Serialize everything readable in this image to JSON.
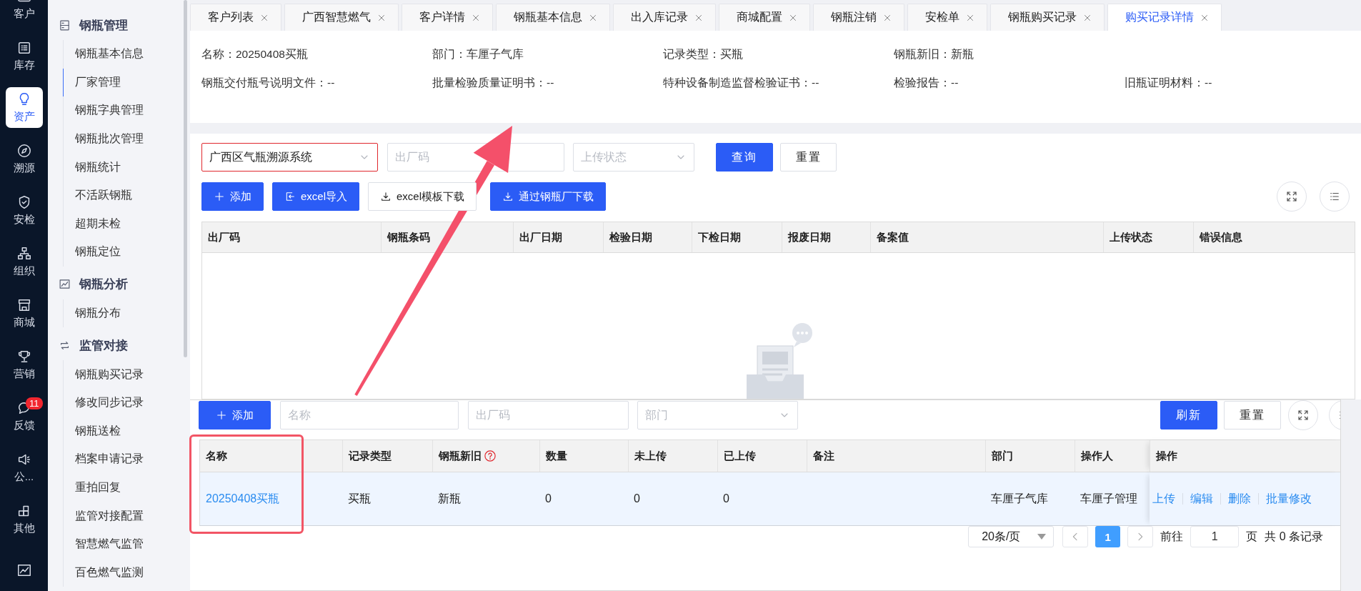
{
  "rail": [
    {
      "label": "客户",
      "selected": false
    },
    {
      "label": "库存",
      "selected": false
    },
    {
      "label": "资产",
      "selected": true
    },
    {
      "label": "溯源",
      "selected": false
    },
    {
      "label": "安检",
      "selected": false
    },
    {
      "label": "组织",
      "selected": false
    },
    {
      "label": "商城",
      "selected": false
    },
    {
      "label": "营销",
      "selected": false
    },
    {
      "label": "反馈",
      "selected": false,
      "badge": "11"
    },
    {
      "label": "公...",
      "selected": false
    },
    {
      "label": "其他",
      "selected": false
    },
    {
      "selected": false
    }
  ],
  "menu": [
    {
      "title": "钢瓶管理",
      "items": [
        {
          "label": "钢瓶基本信息",
          "selected": false
        },
        {
          "label": "厂家管理",
          "selected": true
        },
        {
          "label": "钢瓶字典管理",
          "selected": false
        },
        {
          "label": "钢瓶批次管理",
          "selected": false
        },
        {
          "label": "钢瓶统计",
          "selected": false
        },
        {
          "label": "不活跃钢瓶",
          "selected": false
        },
        {
          "label": "超期未检",
          "selected": false
        },
        {
          "label": "钢瓶定位",
          "selected": false
        }
      ]
    },
    {
      "title": "钢瓶分析",
      "items": [
        {
          "label": "钢瓶分布",
          "selected": false
        }
      ]
    },
    {
      "title": "监管对接",
      "items": [
        {
          "label": "钢瓶购买记录",
          "selected": false
        },
        {
          "label": "修改同步记录",
          "selected": false
        },
        {
          "label": "钢瓶送检",
          "selected": false
        },
        {
          "label": "档案申请记录",
          "selected": false
        },
        {
          "label": "重拍回复",
          "selected": false
        },
        {
          "label": "监管对接配置",
          "selected": false
        },
        {
          "label": "智慧燃气监管",
          "selected": false
        },
        {
          "label": "百色燃气监测",
          "selected": false
        }
      ]
    }
  ],
  "tabs": [
    {
      "label": "客户列表",
      "selected": false
    },
    {
      "label": "广西智慧燃气",
      "selected": false
    },
    {
      "label": "客户详情",
      "selected": false
    },
    {
      "label": "钢瓶基本信息",
      "selected": false
    },
    {
      "label": "出入库记录",
      "selected": false
    },
    {
      "label": "商城配置",
      "selected": false
    },
    {
      "label": "钢瓶注销",
      "selected": false
    },
    {
      "label": "安检单",
      "selected": false
    },
    {
      "label": "钢瓶购买记录",
      "selected": false
    },
    {
      "label": "购买记录详情",
      "selected": true
    }
  ],
  "details": [
    [
      "名称：20250408买瓶",
      "部门：车厘子气库",
      "记录类型：买瓶",
      "钢瓶新旧：新瓶"
    ],
    [
      "钢瓶交付瓶号说明文件：--",
      "批量检验质量证明书：--",
      "特种设备制造监督检验证书：--",
      "检验报告：--",
      "旧瓶证明材料：--"
    ]
  ],
  "filter": {
    "system_select": "广西区气瓶溯源系统",
    "factory_code_placeholder": "出厂码",
    "upload_status_placeholder": "上传状态",
    "search_button": "查询",
    "reset_button": "重置"
  },
  "toolbar": [
    {
      "label": "添加",
      "kind": "add",
      "primary": true
    },
    {
      "label": "excel导入",
      "kind": "import",
      "primary": true
    },
    {
      "label": "excel模板下载",
      "kind": "download",
      "primary": false
    },
    {
      "label": "通过钢瓶厂下载",
      "kind": "download",
      "primary": true
    }
  ],
  "table": {
    "columns": [
      "出厂码",
      "钢瓶条码",
      "出厂日期",
      "检验日期",
      "下检日期",
      "报废日期",
      "备案值",
      "上传状态",
      "错误信息"
    ]
  },
  "purchase_panel": {
    "add_button": "添加",
    "name_placeholder": "名称",
    "code_placeholder": "出厂码",
    "department_placeholder": "部门",
    "refresh_button": "刷新",
    "reset_button": "重置",
    "columns": [
      {
        "label": "名称",
        "help": false
      },
      {
        "label": "记录类型",
        "help": false
      },
      {
        "label": "钢瓶新旧",
        "help": true
      },
      {
        "label": "数量",
        "help": false
      },
      {
        "label": "未上传",
        "help": false
      },
      {
        "label": "已上传",
        "help": false
      },
      {
        "label": "备注",
        "help": false
      },
      {
        "label": "部门",
        "help": false
      },
      {
        "label": "操作人",
        "help": false
      },
      {
        "label": "操作",
        "help": false
      }
    ],
    "rows": [
      {
        "selected": true,
        "cells": [
          "20250408买瓶",
          "买瓶",
          "新瓶",
          "0",
          "0",
          "0",
          "",
          "车厘子气库",
          "车厘子管理"
        ],
        "actions": [
          "上传",
          "编辑",
          "删除",
          "批量修改"
        ]
      }
    ],
    "pagination": {
      "page_size": "20条/页",
      "pages": [
        {
          "label": "1",
          "selected": true
        }
      ],
      "goto_label": "前往",
      "goto_value": "1",
      "page_unit": "页",
      "total": "共 0 条记录"
    }
  }
}
